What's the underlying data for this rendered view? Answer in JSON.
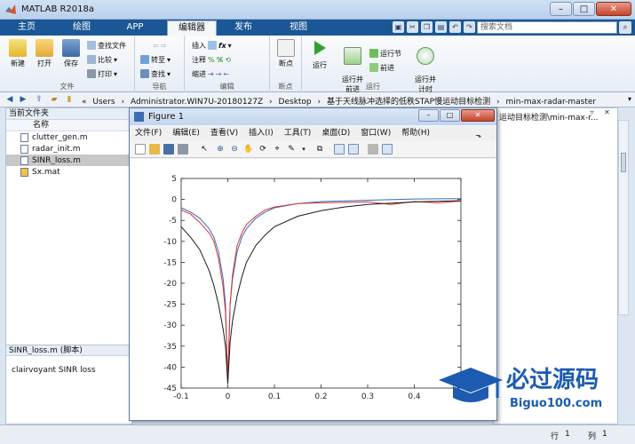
{
  "window": {
    "title": "MATLAB R2018a"
  },
  "tabs": [
    "主页",
    "绘图",
    "APP",
    "编辑器",
    "发布",
    "视图"
  ],
  "active_tab": "编辑器",
  "search": {
    "placeholder": "搜索文档"
  },
  "toolstrip": {
    "file_group": {
      "label": "文件",
      "new": "新建",
      "open": "打开",
      "save": "保存",
      "find_files": "查找文件",
      "compare": "比较",
      "print": "打印"
    },
    "nav_group": {
      "label": "导航",
      "goto": "转至",
      "find": "查找"
    },
    "edit_group": {
      "label": "编辑",
      "insert": "插入",
      "comment": "注释",
      "indent": "缩进"
    },
    "breakpoint_group": {
      "label": "断点",
      "breakpoints": "断点"
    },
    "run_group": {
      "label": "运行",
      "run": "运行",
      "run_advance": "运行并\n前进",
      "run_section": "运行节",
      "advance": "前进",
      "run_time": "运行并\n计时"
    }
  },
  "address": {
    "crumbs": [
      "«",
      "Users",
      "›",
      "Administrator.WIN7U-20180127Z",
      "›",
      "Desktop",
      "›",
      "基于天线脉冲选择的低秩STAP慢运动目标检测",
      "›",
      "min-max-radar-master"
    ]
  },
  "file_browser": {
    "header": "当前文件夹",
    "column": "名称",
    "files": [
      {
        "name": "clutter_gen.m",
        "selected": false
      },
      {
        "name": "radar_init.m",
        "selected": false
      },
      {
        "name": "SINR_loss.m",
        "selected": true
      },
      {
        "name": "Sx.mat",
        "selected": false
      }
    ],
    "detail_header": "SINR_loss.m  (脚本)",
    "detail_text": "clairvoyant SINR loss"
  },
  "editor_path": "运动目标检测\\min-max-r...",
  "status": {
    "row_label": "行",
    "row": "1",
    "col_label": "列",
    "col": "1"
  },
  "figure": {
    "title": "Figure 1",
    "menu": [
      "文件(F)",
      "编辑(E)",
      "查看(V)",
      "插入(I)",
      "工具(T)",
      "桌面(D)",
      "窗口(W)",
      "帮助(H)"
    ]
  },
  "watermark": {
    "text1": "必过源码",
    "text2": "Biguo100.com"
  },
  "chart_data": {
    "type": "line",
    "xlim": [
      -0.1,
      0.5
    ],
    "ylim": [
      -45,
      5
    ],
    "xticks": [
      -0.1,
      0,
      0.1,
      0.2,
      0.3,
      0.4,
      0.5
    ],
    "yticks": [
      5,
      0,
      -5,
      -10,
      -15,
      -20,
      -25,
      -30,
      -35,
      -40,
      -45
    ],
    "xtick_labels": [
      "-0.1",
      "0",
      "0.1",
      "0.2",
      "0.3",
      "0.4",
      "0.5"
    ],
    "ytick_labels": [
      "5",
      "0",
      "-5",
      "-10",
      "-15",
      "-20",
      "-25",
      "-30",
      "-35",
      "-40",
      "-45"
    ],
    "series": [
      {
        "color": "#2f6fc0",
        "x": [
          -0.1,
          -0.08,
          -0.06,
          -0.04,
          -0.03,
          -0.02,
          -0.01,
          -0.005,
          0,
          0.005,
          0.01,
          0.02,
          0.03,
          0.04,
          0.06,
          0.08,
          0.1,
          0.15,
          0.2,
          0.3,
          0.4,
          0.5
        ],
        "y": [
          -2,
          -3,
          -4.5,
          -7,
          -9,
          -12.5,
          -19,
          -25,
          -44,
          -25,
          -19,
          -12.5,
          -9,
          -7,
          -4.5,
          -3,
          -2,
          -1,
          -0.5,
          -0.2,
          0.1,
          0.2
        ]
      },
      {
        "color": "#e0312b",
        "x": [
          -0.1,
          -0.08,
          -0.06,
          -0.04,
          -0.03,
          -0.02,
          -0.01,
          -0.005,
          0,
          0.005,
          0.01,
          0.02,
          0.03,
          0.04,
          0.06,
          0.08,
          0.1,
          0.15,
          0.2,
          0.3,
          0.35,
          0.4,
          0.45,
          0.5
        ],
        "y": [
          -2.5,
          -3.5,
          -5.5,
          -8,
          -10,
          -14,
          -21,
          -27,
          -43,
          -25,
          -18,
          -11,
          -8,
          -6,
          -4,
          -2.5,
          -1.8,
          -1,
          -0.8,
          -0.6,
          -1.2,
          -0.5,
          -0.8,
          -0.4
        ]
      },
      {
        "color": "#1a1a1a",
        "x": [
          -0.1,
          -0.08,
          -0.06,
          -0.04,
          -0.03,
          -0.02,
          -0.01,
          -0.005,
          0,
          0.005,
          0.01,
          0.02,
          0.03,
          0.04,
          0.06,
          0.08,
          0.1,
          0.15,
          0.2,
          0.25,
          0.3,
          0.4,
          0.5
        ],
        "y": [
          -6.5,
          -9,
          -12,
          -17,
          -20.5,
          -25,
          -31,
          -35,
          -44,
          -34,
          -29,
          -23,
          -18.5,
          -15,
          -11,
          -8.5,
          -6.5,
          -4,
          -2.7,
          -1.8,
          -1.2,
          -0.6,
          -0.3
        ]
      }
    ]
  }
}
